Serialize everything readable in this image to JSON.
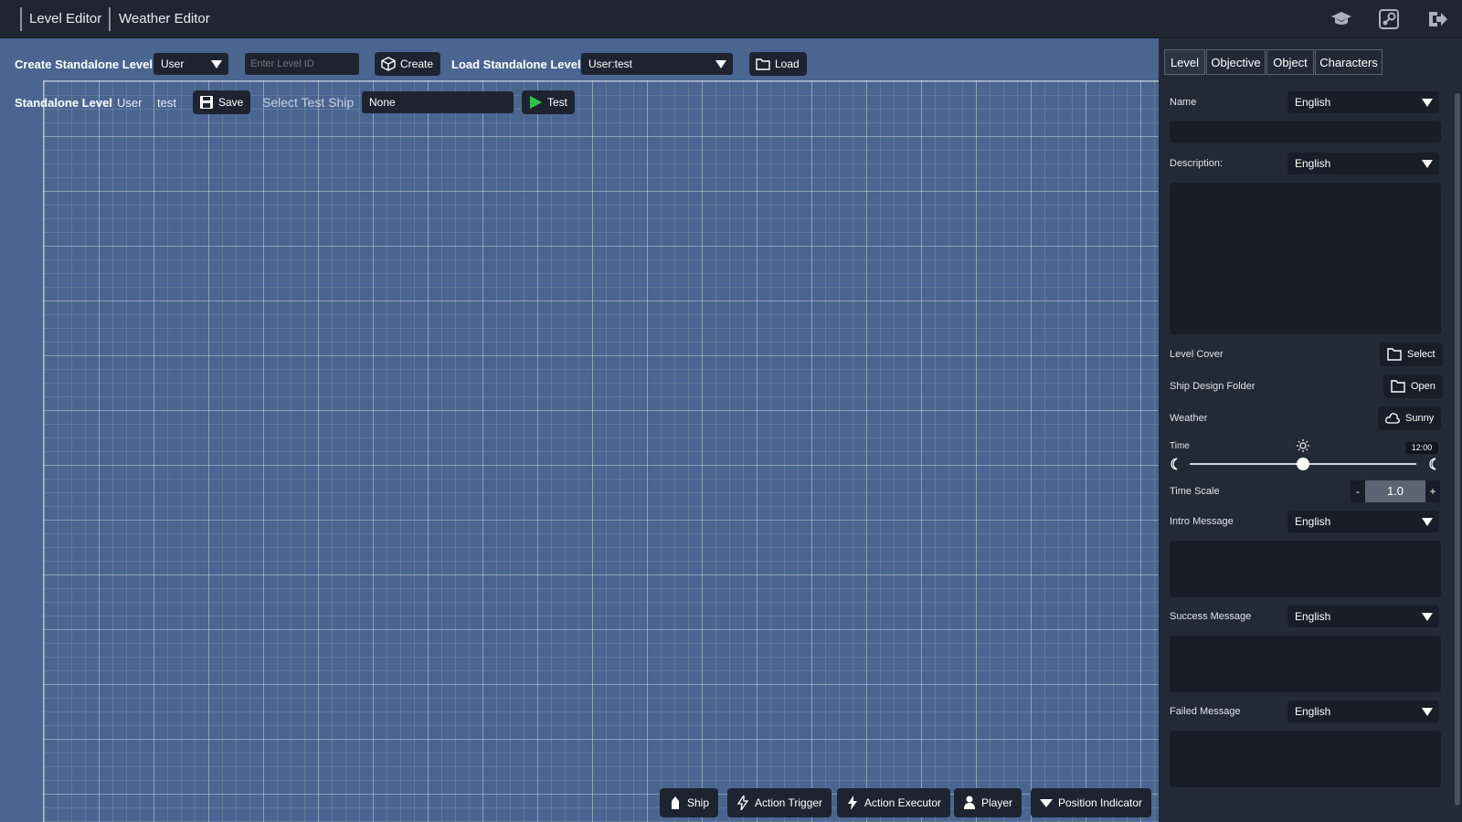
{
  "topbar": {
    "tabs": [
      {
        "label": "Level Editor",
        "active": true
      },
      {
        "label": "Weather Editor",
        "active": false
      }
    ],
    "icons": [
      "graduation-cap-icon",
      "steam-icon",
      "exit-icon"
    ]
  },
  "toolbar": {
    "create_label": "Create Standalone Level",
    "create_scope": "User",
    "level_id_placeholder": "Enter Level ID",
    "create_button": "Create",
    "load_label": "Load Standalone Level",
    "load_selected": "User:test",
    "load_button": "Load"
  },
  "standalone": {
    "label": "Standalone Level",
    "scope": "User",
    "name": "test",
    "save_button": "Save",
    "select_ship_label": "Select Test Ship",
    "ship_value": "None",
    "test_button": "Test"
  },
  "palette": [
    {
      "label": "Ship",
      "icon": "ship-icon"
    },
    {
      "label": "Action Trigger",
      "icon": "lightning-icon"
    },
    {
      "label": "Action Executor",
      "icon": "lightning-icon"
    },
    {
      "label": "Player",
      "icon": "player-icon"
    },
    {
      "label": "Position Indicator",
      "icon": "triangle-down-icon"
    }
  ],
  "panel": {
    "tabs": [
      {
        "label": "Level",
        "active": true
      },
      {
        "label": "Objective",
        "active": false
      },
      {
        "label": "Object",
        "active": false
      },
      {
        "label": "Characters",
        "active": false
      }
    ],
    "name_label": "Name",
    "name_lang": "English",
    "description_label": "Description:",
    "description_lang": "English",
    "level_cover_label": "Level Cover",
    "level_cover_button": "Select",
    "ship_folder_label": "Ship Design Folder",
    "ship_folder_button": "Open",
    "weather_label": "Weather",
    "weather_button": "Sunny",
    "time_label": "Time",
    "time_value": "12:00",
    "time_fraction": 0.5,
    "time_scale_label": "Time Scale",
    "time_scale_value": "1.0",
    "time_scale_minus": "-",
    "time_scale_plus": "+",
    "intro_label": "Intro Message",
    "intro_lang": "English",
    "success_label": "Success Message",
    "success_lang": "English",
    "failed_label": "Failed Message",
    "failed_lang": "English"
  },
  "colors": {
    "canvas": "#4a6590",
    "panel": "#222a36",
    "topbar": "#1f2632",
    "control": "#1d2430",
    "play_green": "#2fc24a"
  }
}
